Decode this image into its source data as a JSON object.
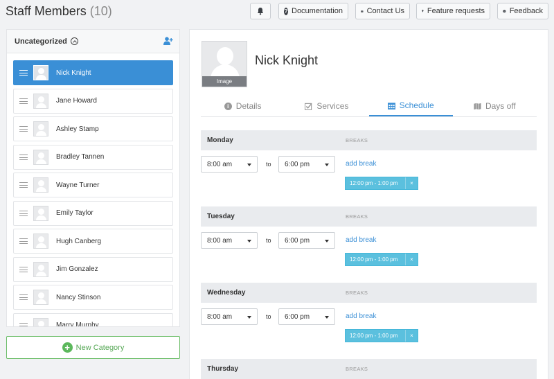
{
  "header": {
    "title": "Staff Members",
    "count": "(10)",
    "buttons": {
      "documentation": "Documentation",
      "contact": "Contact Us",
      "feature": "Feature requests",
      "feedback": "Feedback"
    }
  },
  "sidebar": {
    "category": "Uncategorized",
    "staff": [
      "Nick Knight",
      "Jane Howard",
      "Ashley Stamp",
      "Bradley Tannen",
      "Wayne Turner",
      "Emily Taylor",
      "Hugh Canberg",
      "Jim Gonzalez",
      "Nancy Stinson",
      "Marry Murphy"
    ],
    "new_category": "New Category"
  },
  "profile": {
    "name": "Nick Knight",
    "image_caption": "Image"
  },
  "tabs": {
    "details": "Details",
    "services": "Services",
    "schedule": "Schedule",
    "days_off": "Days off"
  },
  "schedule": {
    "breaks_label": "BREAKS",
    "to_label": "to",
    "add_break": "add break",
    "days": [
      {
        "name": "Monday",
        "start": "8:00 am",
        "end": "6:00 pm",
        "break": "12:00 pm - 1:00 pm"
      },
      {
        "name": "Tuesday",
        "start": "8:00 am",
        "end": "6:00 pm",
        "break": "12:00 pm - 1:00 pm"
      },
      {
        "name": "Wednesday",
        "start": "8:00 am",
        "end": "6:00 pm",
        "break": "12:00 pm - 1:00 pm"
      },
      {
        "name": "Thursday"
      }
    ],
    "break_remove": "×"
  },
  "colors": {
    "accent": "#3a8fd6",
    "break_chip": "#5bc0de",
    "success": "#5cb85c"
  }
}
